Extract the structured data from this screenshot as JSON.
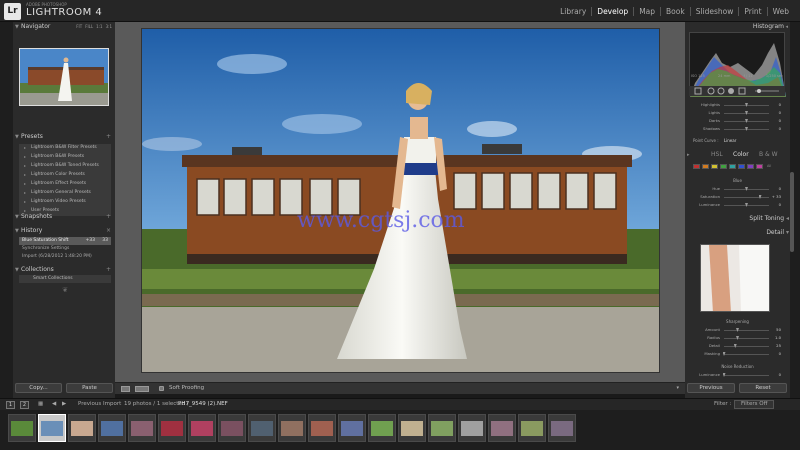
{
  "app": {
    "logo": "Lr",
    "brand_small": "ADOBE PHOTOSHOP",
    "brand": "LIGHTROOM 4"
  },
  "modules": [
    {
      "label": "Library",
      "active": false
    },
    {
      "label": "Develop",
      "active": true
    },
    {
      "label": "Map",
      "active": false
    },
    {
      "label": "Book",
      "active": false
    },
    {
      "label": "Slideshow",
      "active": false
    },
    {
      "label": "Print",
      "active": false
    },
    {
      "label": "Web",
      "active": false
    }
  ],
  "left_panel": {
    "navigator": {
      "title": "Navigator",
      "options": [
        "FIT",
        "FILL",
        "1:1",
        "3:1"
      ]
    },
    "presets": {
      "title": "Presets",
      "items": [
        "Lightroom B&W Filter Presets",
        "Lightroom B&W Presets",
        "Lightroom B&W Toned Presets",
        "Lightroom Color Presets",
        "Lightroom Effect Presets",
        "Lightroom General Presets",
        "Lightroom Video Presets",
        "User Presets"
      ]
    },
    "snapshots": {
      "title": "Snapshots"
    },
    "history": {
      "title": "History",
      "items": [
        {
          "label": "Blue Saturation Shift",
          "val": "+33",
          "val2": "33"
        },
        {
          "label": "Synchronize Settings",
          "val": "",
          "val2": ""
        },
        {
          "label": "Import (6/28/2012 1:48:20 PM)",
          "val": "",
          "val2": ""
        }
      ]
    },
    "collections": {
      "title": "Collections",
      "items": [
        "Smart Collections"
      ]
    },
    "copy_label": "Copy...",
    "paste_label": "Paste"
  },
  "toolbar": {
    "soft_proofing": "Soft Proofing"
  },
  "watermark": "www.cgtsj.com",
  "right_panel": {
    "histogram_title": "Histogram",
    "hist_info": [
      "ISO 125",
      "24 mm",
      "f / 11",
      "1/250 sec"
    ],
    "tone_sliders": [
      {
        "label": "Highlights",
        "pos": 0.5,
        "num": "0"
      },
      {
        "label": "Lights",
        "pos": 0.5,
        "num": "0"
      },
      {
        "label": "Darks",
        "pos": 0.5,
        "num": "0"
      },
      {
        "label": "Shadows",
        "pos": 0.5,
        "num": "0"
      }
    ],
    "point_curve_label": "Point Curve :",
    "point_curve_value": "Linear",
    "hsl_tabs": [
      "HSL",
      "Color",
      "B & W"
    ],
    "color_labels": [
      "R",
      "O",
      "Y",
      "G",
      "A",
      "B",
      "P",
      "M",
      "All"
    ],
    "color_chips": [
      "#c03030",
      "#d07a20",
      "#d0c030",
      "#40a040",
      "#30a0a0",
      "#3050d0",
      "#8040c0",
      "#c040a0"
    ],
    "blue_section": "Blue",
    "blue_sliders": [
      {
        "label": "Hue",
        "pos": 0.5,
        "num": "0"
      },
      {
        "label": "Saturation",
        "pos": 0.8,
        "num": "+ 33"
      },
      {
        "label": "Luminance",
        "pos": 0.5,
        "num": "0"
      }
    ],
    "split_toning_title": "Split Toning",
    "detail_title": "Detail",
    "sharpening_label": "Sharpening",
    "sharpening": [
      {
        "label": "Amount",
        "pos": 0.3,
        "num": "50"
      },
      {
        "label": "Radius",
        "pos": 0.3,
        "num": "1.0"
      },
      {
        "label": "Detail",
        "pos": 0.25,
        "num": "25"
      },
      {
        "label": "Masking",
        "pos": 0.0,
        "num": "0"
      }
    ],
    "noise_label": "Noise Reduction",
    "noise": [
      {
        "label": "Luminance",
        "pos": 0.0,
        "num": "0"
      }
    ],
    "previous_label": "Previous",
    "reset_label": "Reset"
  },
  "film_bar": {
    "page1": "1",
    "page2": "2",
    "source": "Previous Import",
    "count": "19 photos / 1 selected /",
    "filename": "PH7_9549 (2).NEF",
    "filter_label": "Filter :",
    "filter_value": "Filters Off"
  },
  "filmstrip": {
    "frames": [
      {
        "color": "#5a8a3a",
        "selected": false
      },
      {
        "color": "#6a8fb8",
        "selected": true
      },
      {
        "color": "#c8a890",
        "selected": false
      },
      {
        "color": "#5070a0",
        "selected": false
      },
      {
        "color": "#8a6070",
        "selected": false
      },
      {
        "color": "#a03040",
        "selected": false
      },
      {
        "color": "#b04060",
        "selected": false
      },
      {
        "color": "#7a5060",
        "selected": false
      },
      {
        "color": "#506070",
        "selected": false
      },
      {
        "color": "#907060",
        "selected": false
      },
      {
        "color": "#a06050",
        "selected": false
      },
      {
        "color": "#6070a0",
        "selected": false
      },
      {
        "color": "#70a050",
        "selected": false
      },
      {
        "color": "#c0b090",
        "selected": false
      },
      {
        "color": "#80a060",
        "selected": false
      },
      {
        "color": "#a0a0a0",
        "selected": false
      },
      {
        "color": "#907080",
        "selected": false
      },
      {
        "color": "#8a9a60",
        "selected": false
      },
      {
        "color": "#7a6a80",
        "selected": false
      }
    ]
  },
  "colors": {
    "accent_active": "#ffffff",
    "panel_bg": "#2b2b2b",
    "center_bg": "#5a5a5a"
  }
}
